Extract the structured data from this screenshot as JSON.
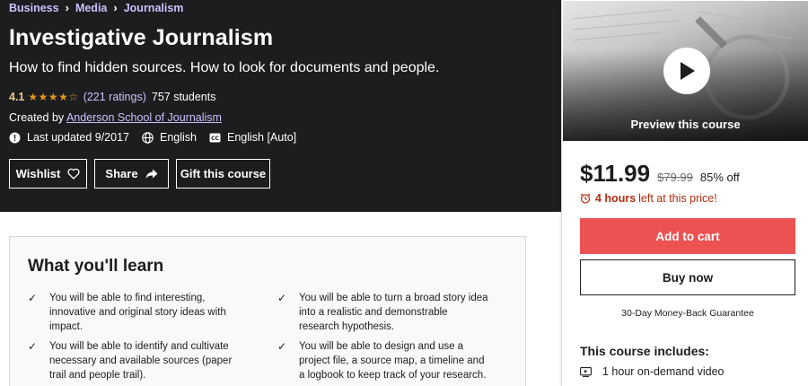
{
  "breadcrumb": [
    "Business",
    "Media",
    "Journalism"
  ],
  "breadcrumb_separator": "›",
  "course": {
    "title": "Investigative Journalism",
    "subtitle": "How to find hidden sources. How to look for documents and people.",
    "rating": "4.1",
    "stars": "★★★★☆",
    "ratings_count": "(221 ratings)",
    "students": "757 students",
    "created_by_label": "Created by",
    "author": "Anderson School of Journalism",
    "last_updated": "Last updated 9/2017",
    "language": "English",
    "captions": "English [Auto]"
  },
  "actions": {
    "wishlist": "Wishlist",
    "share": "Share",
    "gift": "Gift this course"
  },
  "sidebar": {
    "preview_label": "Preview this course",
    "price": "$11.99",
    "original_price": "$79.99",
    "discount": "85% off",
    "timer_bold": "4 hours",
    "timer_rest": "left at this price!",
    "add_to_cart": "Add to cart",
    "buy_now": "Buy now",
    "guarantee": "30-Day Money-Back Guarantee",
    "includes_title": "This course includes:",
    "includes": [
      "1 hour on-demand video"
    ]
  },
  "learn": {
    "title": "What you'll learn",
    "items": [
      "You will be able to find interesting, innovative and original story ideas with impact.",
      "You will be able to turn a broad story idea into a realistic and demonstrable research hypothesis.",
      "You will be able to identify and cultivate necessary and available sources (paper trail and people trail).",
      "You will be able to design and use a project file, a source map, a timeline and a logbook to keep track of your research."
    ]
  },
  "colors": {
    "hero_bg": "#1c1d1f",
    "link_purple": "#cec0fc",
    "rating_gold": "#f3ca8c",
    "star_orange": "#e59819",
    "cart_red": "#ec5252",
    "timer_red": "#b32d0f"
  },
  "icons": [
    "chevron-right-icon",
    "star-icon",
    "alert-badge-icon",
    "globe-icon",
    "cc-icon",
    "heart-icon",
    "share-arrow-icon",
    "play-icon",
    "alarm-clock-icon",
    "video-icon",
    "check-icon"
  ]
}
